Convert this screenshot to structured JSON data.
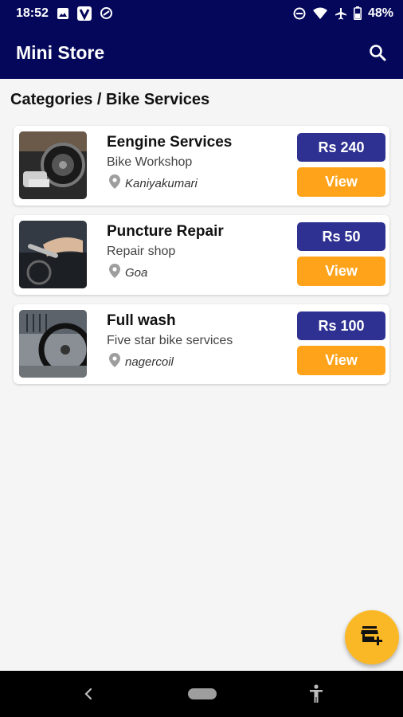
{
  "status_bar": {
    "time": "18:52",
    "battery": "48%",
    "left_icons": [
      "photo-icon",
      "v-app-icon",
      "data-saver-icon"
    ],
    "right_icons": [
      "dnd-icon",
      "wifi-icon",
      "airplane-icon",
      "battery-icon"
    ]
  },
  "app_bar": {
    "title": "Mini Store",
    "search_icon": "search-icon"
  },
  "breadcrumb": "Categories / Bike Services",
  "services": [
    {
      "title": "Eengine Services",
      "subtitle": "Bike Workshop",
      "location": "Kaniyakumari",
      "price": "Rs 240",
      "view_label": "View",
      "image": "engine-brake-photo"
    },
    {
      "title": "Puncture Repair",
      "subtitle": "Repair shop",
      "location": "Goa",
      "price": "Rs 50",
      "view_label": "View",
      "image": "bike-repair-photo"
    },
    {
      "title": "Full wash",
      "subtitle": "Five star bike services",
      "location": "nagercoil",
      "price": "Rs 100",
      "view_label": "View",
      "image": "bike-wheel-photo"
    }
  ],
  "fab_icon": "add-store-icon",
  "colors": {
    "primary": "#04075a",
    "price_badge": "#2e3192",
    "view_button": "#ffa31a",
    "fab": "#fbb826"
  }
}
